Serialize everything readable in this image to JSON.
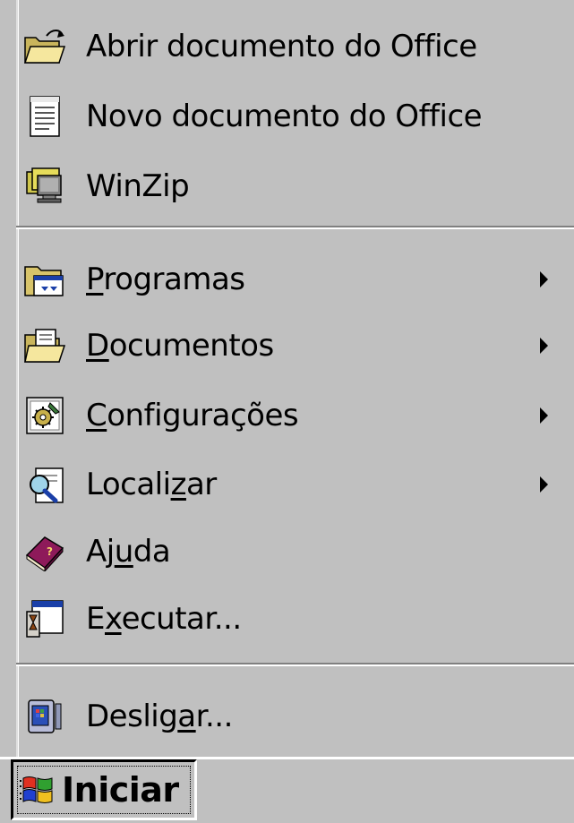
{
  "start_menu": {
    "top_items": [
      {
        "label": "Abrir documento do Office",
        "icon": "open-folder-icon"
      },
      {
        "label": "Novo documento do Office",
        "icon": "new-document-icon"
      },
      {
        "label": "WinZip",
        "icon": "winzip-icon"
      }
    ],
    "main_items": [
      {
        "label_pre": "",
        "label_mnemonic": "P",
        "label_post": "rogramas",
        "icon": "programs-icon",
        "has_submenu": true
      },
      {
        "label_pre": "",
        "label_mnemonic": "D",
        "label_post": "ocumentos",
        "icon": "documents-icon",
        "has_submenu": true
      },
      {
        "label_pre": "",
        "label_mnemonic": "C",
        "label_post": "onfigurações",
        "icon": "settings-icon",
        "has_submenu": true
      },
      {
        "label_pre": "Locali",
        "label_mnemonic": "z",
        "label_post": "ar",
        "icon": "find-icon",
        "has_submenu": true
      },
      {
        "label_pre": "Aj",
        "label_mnemonic": "u",
        "label_post": "da",
        "icon": "help-book-icon",
        "has_submenu": false
      },
      {
        "label_pre": "E",
        "label_mnemonic": "x",
        "label_post": "ecutar...",
        "icon": "run-icon",
        "has_submenu": false
      }
    ],
    "bottom_items": [
      {
        "label_pre": "Deslig",
        "label_mnemonic": "a",
        "label_post": "r...",
        "icon": "shutdown-icon",
        "has_submenu": false
      }
    ]
  },
  "taskbar": {
    "start_button_label": "Iniciar",
    "start_icon": "windows-logo-icon"
  },
  "colors": {
    "face": "#c0c0c0",
    "highlight": "#ffffff",
    "shadow": "#808080",
    "text": "#000000"
  }
}
